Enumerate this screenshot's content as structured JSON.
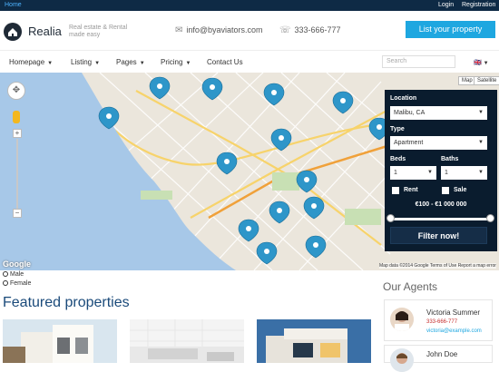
{
  "topbar": {
    "home": "Home",
    "login": "Login",
    "registration": "Registration"
  },
  "header": {
    "logo": "Realia",
    "tagline": "Real estate & Rental made easy",
    "email": "info@byaviators.com",
    "phone": "333-666-777",
    "list_button": "List your property"
  },
  "nav": {
    "items": [
      {
        "label": "Homepage"
      },
      {
        "label": "Listing"
      },
      {
        "label": "Pages"
      },
      {
        "label": "Pricing"
      },
      {
        "label": "Contact Us"
      }
    ],
    "search_placeholder": "Search",
    "flag": "🇬🇧"
  },
  "map": {
    "type_map": "Map",
    "type_satellite": "Satellite",
    "google": "Google",
    "attribution": "Map data ©2014 Google   Terms of Use   Report a map error"
  },
  "filter": {
    "location_label": "Location",
    "location_value": "Malibu, CA",
    "type_label": "Type",
    "type_value": "Apartment",
    "beds_label": "Beds",
    "beds_value": "1",
    "baths_label": "Baths",
    "baths_value": "1",
    "rent_label": "Rent",
    "sale_label": "Sale",
    "price_range": "€100 - €1 000 000",
    "button": "Filter now!"
  },
  "gender": {
    "male": "Male",
    "female": "Female"
  },
  "featured_title": "Featured properties",
  "agents_title": "Our Agents",
  "agents": [
    {
      "name": "Victoria Summer",
      "phone": "333-666-777",
      "email": "victoria@example.com"
    },
    {
      "name": "John Doe",
      "phone": "",
      "email": ""
    }
  ],
  "colors": {
    "accent": "#1ea7e0",
    "dark": "#0a1c2e",
    "pin": "#2e96c9"
  }
}
